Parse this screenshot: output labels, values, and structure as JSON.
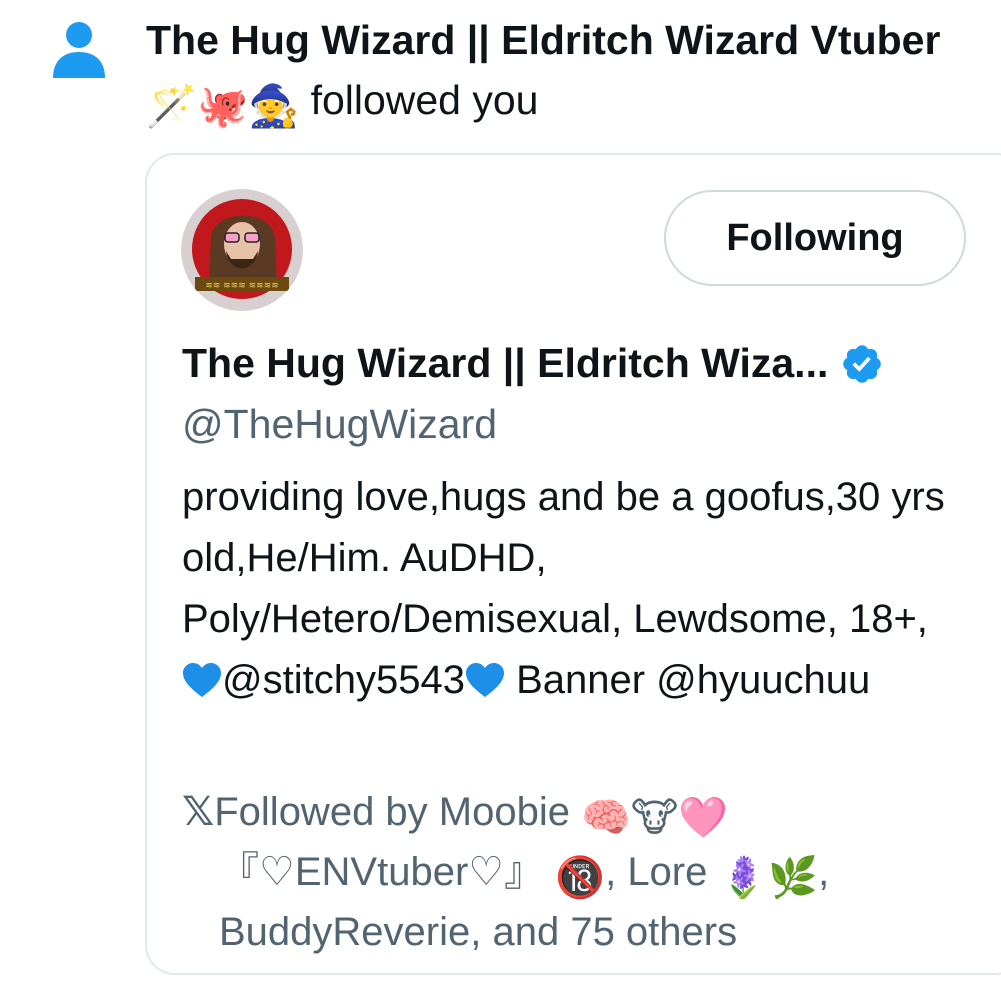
{
  "notification": {
    "icon": "person-icon",
    "actor_name": "The Hug Wizard || Eldritch Wizard Vtuber",
    "actor_emojis": "🪄🐙🧙",
    "action": "followed you"
  },
  "card": {
    "avatar": "profile-avatar",
    "follow_button_label": "Following",
    "display_name": "The Hug Wizard || Eldritch Wiza...",
    "verified_icon": "verified-badge-icon",
    "handle": "@TheHugWizard",
    "bio": {
      "text_1": "providing love,hugs and be a goofus,30 yrs old,He/Him. AuDHD, Poly/Hetero/Demisexual, Lewdsome, 18+, ",
      "mention_1": "@stitchy5543",
      "text_2": " Banner ",
      "mention_2": "@hyuuchuu"
    },
    "followed_by": {
      "prefix": "Followed by ",
      "name_1": "Moobie",
      "name_1_emojis": "🧠🐮🩷",
      "name_2": "『♡ENVtuber♡』",
      "name_2_emoji": "🔞",
      "name_3": "Lore",
      "name_3_emojis": "🪻🌿",
      "name_4": "BuddyReverie",
      "suffix": ", and 75 others"
    }
  },
  "colors": {
    "accent_blue": "#1d9bf0",
    "text_primary": "#0f1419",
    "text_secondary": "#536471",
    "border": "#cfd9de"
  }
}
